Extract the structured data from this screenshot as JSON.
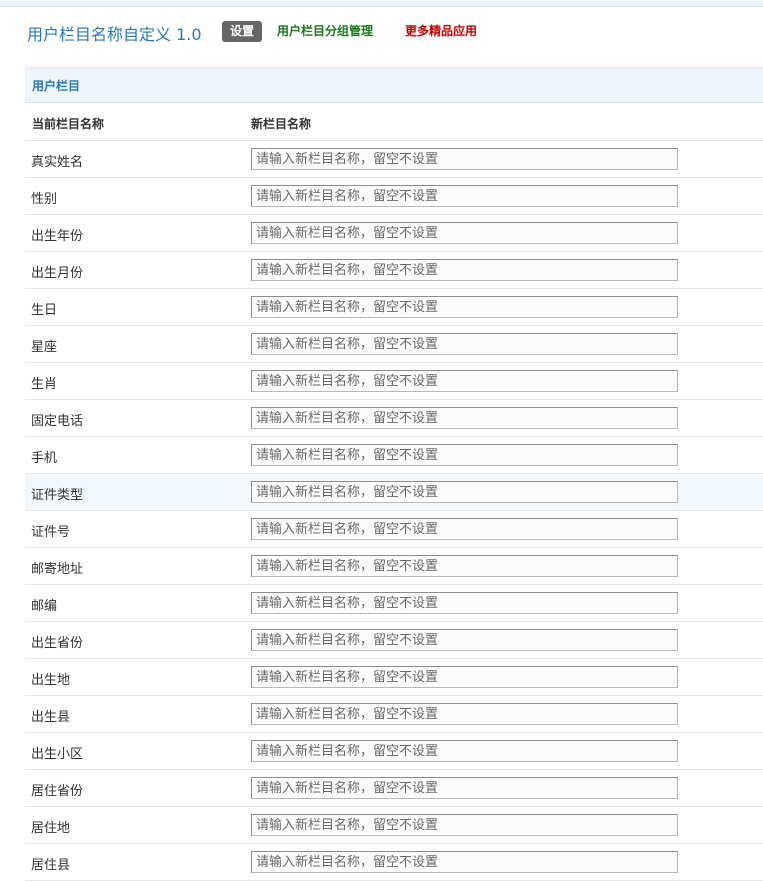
{
  "header": {
    "app_title": "用户栏目名称自定义 1.0",
    "nav": {
      "settings": "设置",
      "group_manage": "用户栏目分组管理",
      "more_apps": "更多精品应用"
    }
  },
  "section": {
    "title": "用户栏目",
    "col_current": "当前栏目名称",
    "col_new": "新栏目名称"
  },
  "input_placeholder": "请输入新栏目名称，留空不设置",
  "fields": [
    {
      "label": "真实姓名",
      "value": ""
    },
    {
      "label": "性别",
      "value": ""
    },
    {
      "label": "出生年份",
      "value": ""
    },
    {
      "label": "出生月份",
      "value": ""
    },
    {
      "label": "生日",
      "value": ""
    },
    {
      "label": "星座",
      "value": ""
    },
    {
      "label": "生肖",
      "value": ""
    },
    {
      "label": "固定电话",
      "value": ""
    },
    {
      "label": "手机",
      "value": ""
    },
    {
      "label": "证件类型",
      "value": ""
    },
    {
      "label": "证件号",
      "value": ""
    },
    {
      "label": "邮寄地址",
      "value": ""
    },
    {
      "label": "邮编",
      "value": ""
    },
    {
      "label": "出生省份",
      "value": ""
    },
    {
      "label": "出生地",
      "value": ""
    },
    {
      "label": "出生县",
      "value": ""
    },
    {
      "label": "出生小区",
      "value": ""
    },
    {
      "label": "居住省份",
      "value": ""
    },
    {
      "label": "居住地",
      "value": ""
    },
    {
      "label": "居住县",
      "value": ""
    }
  ]
}
